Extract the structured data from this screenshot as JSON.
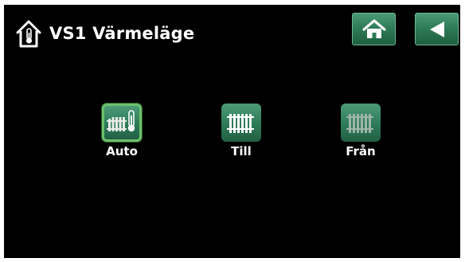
{
  "header": {
    "title": "VS1 Värmeläge",
    "header_icon": "house-thermometer-icon",
    "buttons": [
      {
        "name": "home",
        "icon": "home-icon"
      },
      {
        "name": "back",
        "icon": "back-arrow-icon"
      }
    ]
  },
  "modes": [
    {
      "label": "Auto",
      "icon": "radiator-thermometer-icon",
      "selected": true
    },
    {
      "label": "Till",
      "icon": "radiator-icon",
      "selected": false
    },
    {
      "label": "Från",
      "icon": "radiator-off-icon",
      "selected": false
    }
  ],
  "colors": {
    "background": "#000000",
    "button_green": "#2f7c59",
    "selected_border": "#6cc16a",
    "text": "#ffffff"
  }
}
